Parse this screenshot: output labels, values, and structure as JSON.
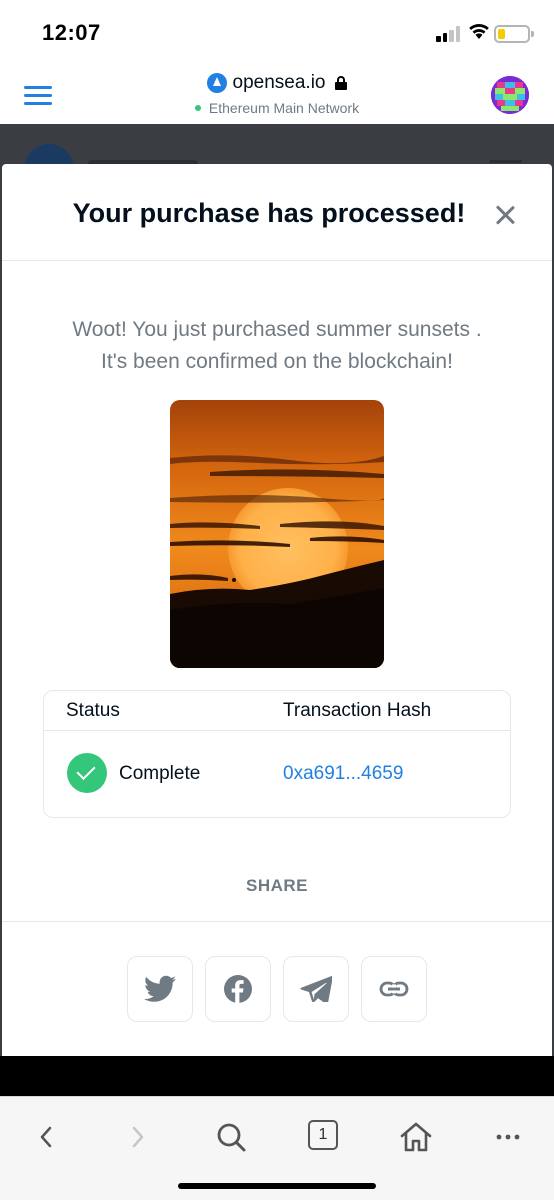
{
  "status_bar": {
    "time": "12:07"
  },
  "browser": {
    "domain": "opensea.io",
    "network": "Ethereum Main Network"
  },
  "modal": {
    "title": "Your purchase has processed!",
    "message_line1": "Woot! You just purchased summer sunsets .",
    "message_line2": "It's been confirmed on the blockchain!",
    "table": {
      "col_status": "Status",
      "col_hash": "Transaction Hash",
      "status_value": "Complete",
      "hash_value": "0xa691...4659"
    },
    "share_label": "SHARE",
    "share_buttons": [
      "twitter-icon",
      "facebook-icon",
      "telegram-icon",
      "link-icon"
    ]
  },
  "bottom_bar": {
    "tab_count": "1"
  },
  "colors": {
    "accent": "#2081e2",
    "success": "#34c77b",
    "muted_text": "#707a83",
    "title_text": "#04111d"
  }
}
